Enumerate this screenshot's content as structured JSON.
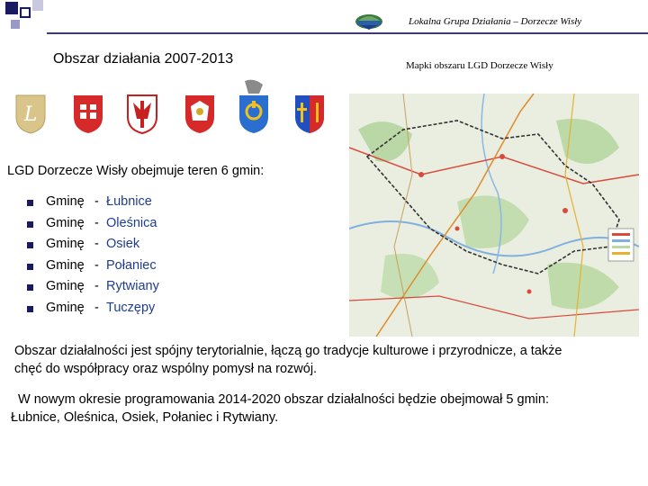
{
  "header": {
    "org_text": "Lokalna Grupa Działania – Dorzecze Wisły",
    "logo_icon": "lgd-logo-icon"
  },
  "left_title": "Obszar działania 2007-2013",
  "map_title": "Mapki obszaru LGD Dorzecze Wisły",
  "coats_of_arms": [
    {
      "icon": "lubnice-coat-of-arms-icon"
    },
    {
      "icon": "olesnica-coat-of-arms-icon"
    },
    {
      "icon": "osiek-coat-of-arms-icon"
    },
    {
      "icon": "polaniec-coat-of-arms-icon"
    },
    {
      "icon": "rytwiany-coat-of-arms-icon"
    },
    {
      "icon": "tuczepy-coat-of-arms-icon"
    }
  ],
  "intro": "LGD  Dorzecze Wisły obejmuje teren 6 gmin:",
  "gminy": [
    {
      "label": "Gminę",
      "dash": "-",
      "name": "Łubnice"
    },
    {
      "label": "Gminę",
      "dash": "-",
      "name": "Oleśnica"
    },
    {
      "label": "Gminę",
      "dash": "-",
      "name": "Osiek"
    },
    {
      "label": "Gminę",
      "dash": "-",
      "name": "Połaniec"
    },
    {
      "label": "Gminę",
      "dash": "-",
      "name": "Rytwiany"
    },
    {
      "label": "Gminę",
      "dash": "-",
      "name": "Tuczępy"
    }
  ],
  "paragraph1_line1": "Obszar działalności jest spójny terytorialnie, łączą go tradycje kulturowe  i przyrodnicze, a także",
  "paragraph1_line2": "chęć do współpracy oraz wspólny pomysł na rozwój.",
  "paragraph2_line1": "W nowym okresie programowania 2014-2020  obszar działalności  będzie obejmował 5 gmin:",
  "paragraph2_line2": "Łubnice, Oleśnica, Osiek, Połaniec i Rytwiany.",
  "colors": {
    "accent_dark": "#1a1a60",
    "gmina_blue": "#1f3d8f",
    "header_line": "#3b3b7a"
  }
}
